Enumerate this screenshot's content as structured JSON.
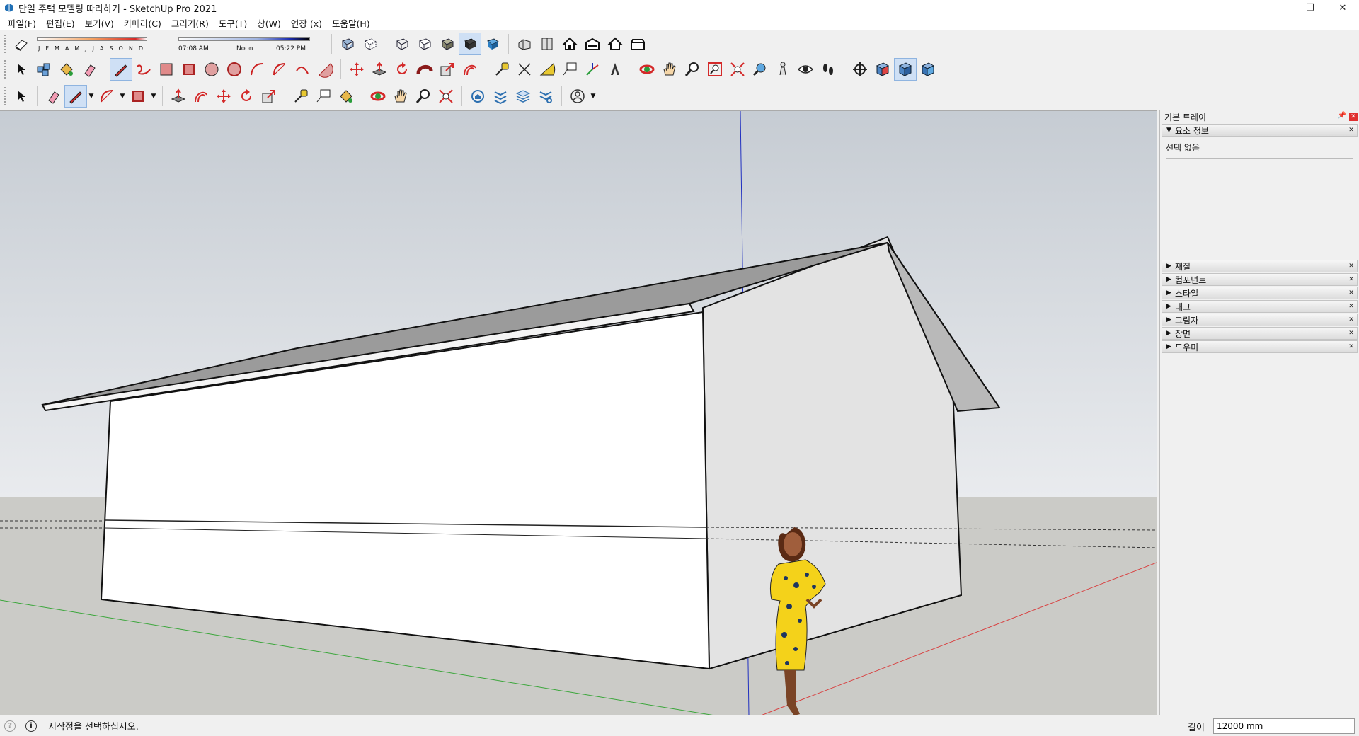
{
  "window": {
    "title": "단일 주택 모델링 따라하기 - SketchUp Pro 2021",
    "controls": [
      "—",
      "❐",
      "✕"
    ]
  },
  "menu": [
    "파일(F)",
    "편집(E)",
    "보기(V)",
    "카메라(C)",
    "그리기(R)",
    "도구(T)",
    "창(W)",
    "연장 (x)",
    "도움말(H)"
  ],
  "shadow": {
    "months": [
      "J",
      "F",
      "M",
      "A",
      "M",
      "J",
      "J",
      "A",
      "S",
      "O",
      "N",
      "D"
    ],
    "time_start": "07:08 AM",
    "time_mid": "Noon",
    "time_end": "05:22 PM"
  },
  "tray": {
    "title": "기본 트레이",
    "entity_panel": "요소 정보",
    "entity_text": "선택 없음",
    "panels": [
      "재질",
      "컴포넌트",
      "스타일",
      "태그",
      "그림자",
      "장면",
      "도우미"
    ]
  },
  "status": {
    "message": "시작점을 선택하십시오.",
    "vcb_label": "길이",
    "vcb_value": "12000 mm"
  },
  "colors": {
    "sky_top": "#c9ced5",
    "sky_bottom": "#e7eaee",
    "ground": "#c9c9c5",
    "roof": "#9a9a9a",
    "wall_side": "#e4e4e4",
    "dress": "#f4d21a"
  }
}
